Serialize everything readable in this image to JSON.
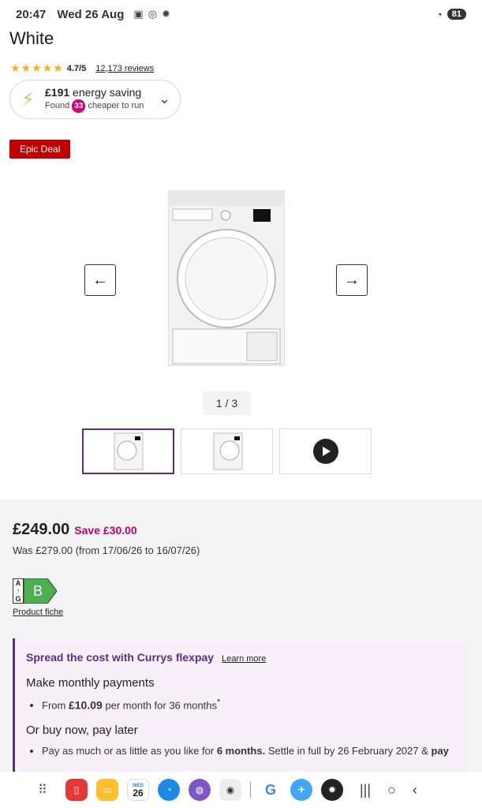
{
  "status": {
    "time": "20:47",
    "date": "Wed 26 Aug",
    "battery": "81"
  },
  "product": {
    "title": "White",
    "rating": "4.7/5",
    "reviews": "12,173 reviews",
    "energy": {
      "amount": "£191",
      "label": "energy saving",
      "found": "Found",
      "count": "33",
      "cheaper": "cheaper to run"
    },
    "deal_badge": "Epic Deal",
    "image_counter": "1 / 3"
  },
  "pricing": {
    "price": "£249.00",
    "save": "Save £30.00",
    "was": "Was £279.00 (from 17/06/26 to 16/07/26)",
    "energy_class": "B",
    "fiche": "Product fiche"
  },
  "flexpay": {
    "title": "Spread the cost with Currys flexpay",
    "learn_more": "Learn more",
    "monthly_heading": "Make monthly payments",
    "monthly_prefix": "From ",
    "monthly_amount": "£10.09",
    "monthly_suffix": " per month for 36 months",
    "monthly_mark": "*",
    "later_heading": "Or buy now, pay later",
    "later_text_1": "Pay as much or as little as you like for ",
    "later_bold": "6 months.",
    "later_text_2": " Settle in full by 26 February 2027 & ",
    "later_bold_2": "pay"
  },
  "navbar": {
    "calendar_day": "26",
    "calendar_wed": "WED"
  },
  "colors": {
    "accent": "#5a2d82",
    "deal": "#c10000",
    "save": "#c1006e",
    "energy_b": "#4caf50"
  }
}
